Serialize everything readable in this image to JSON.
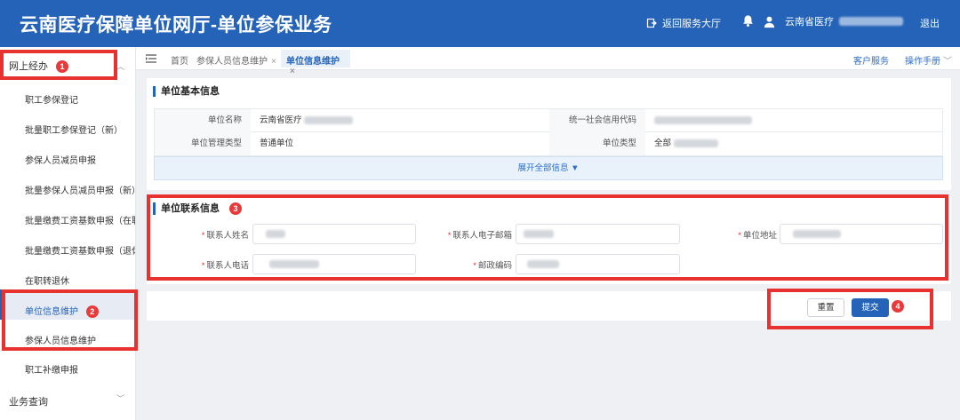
{
  "header": {
    "title": "云南医疗保障单位网厅-单位参保业务",
    "back_label": "返回服务大厅",
    "user_name": "云南省医疗",
    "logout_label": "退出"
  },
  "sidebar": {
    "group1_label": "网上经办",
    "group1_badge": "1",
    "items": [
      {
        "label": "职工参保登记"
      },
      {
        "label": "批量职工参保登记（新）"
      },
      {
        "label": "参保人员减员申报"
      },
      {
        "label": "批量参保人员减员申报（新）"
      },
      {
        "label": "批量缴费工资基数申报（在职"
      },
      {
        "label": "批量缴费工资基数申报（退休"
      },
      {
        "label": "在职转退休"
      },
      {
        "label": "单位信息维护"
      },
      {
        "label": "参保人员信息维护"
      },
      {
        "label": "职工补缴申报"
      }
    ],
    "active_badge": "2",
    "group2_label": "业务查询"
  },
  "tabs": {
    "home": "首页",
    "tab1": "参保人员信息维护",
    "active": "单位信息维护",
    "customer_service": "客户服务",
    "manual": "操作手册"
  },
  "basic_info": {
    "title": "单位基本信息",
    "name_label": "单位名称",
    "name_value": "云南省医疗",
    "credit_label": "统一社会信用代码",
    "mgmt_type_label": "单位管理类型",
    "mgmt_type_value": "普通单位",
    "unit_type_label": "单位类型",
    "unit_type_value": "全部",
    "expand_label": "展开全部信息 ▼"
  },
  "contact_info": {
    "title": "单位联系信息",
    "badge": "3",
    "contact_name_label": "联系人姓名",
    "contact_email_label": "联系人电子邮箱",
    "address_label": "单位地址",
    "contact_phone_label": "联系人电话",
    "postcode_label": "邮政编码"
  },
  "actions": {
    "reset_label": "重置",
    "submit_label": "提交",
    "badge": "4"
  },
  "colors": {
    "brand": "#2563b8",
    "highlight": "#e8322f"
  }
}
